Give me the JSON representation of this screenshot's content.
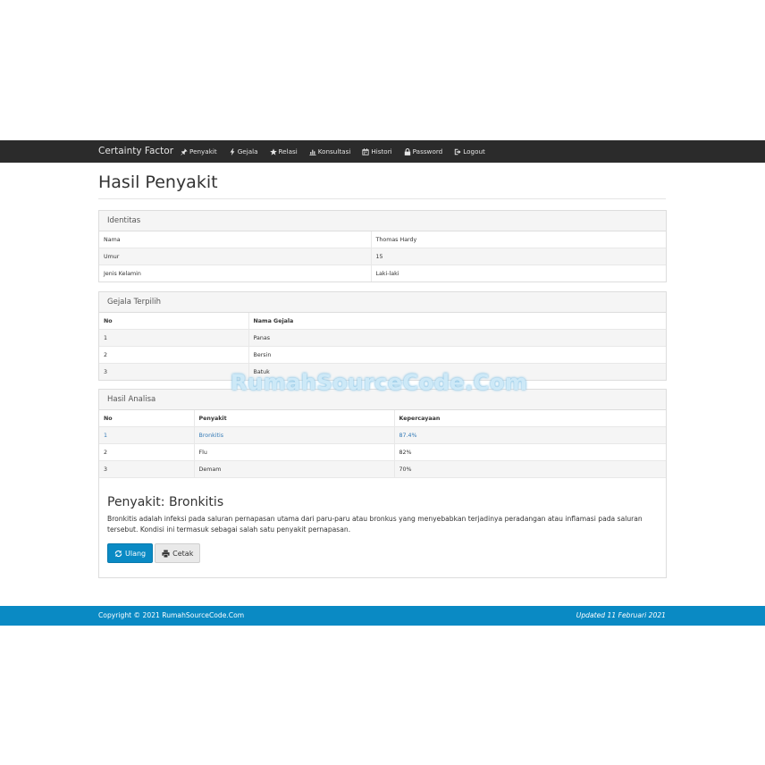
{
  "navbar": {
    "brand": "Certainty Factor",
    "items": [
      {
        "label": "Penyakit",
        "icon": "pushpin-icon"
      },
      {
        "label": "Gejala",
        "icon": "flash-icon"
      },
      {
        "label": "Relasi",
        "icon": "star-icon"
      },
      {
        "label": "Konsultasi",
        "icon": "stats-icon"
      },
      {
        "label": "Histori",
        "icon": "calendar-icon"
      },
      {
        "label": "Password",
        "icon": "lock-icon"
      },
      {
        "label": "Logout",
        "icon": "logout-icon"
      }
    ]
  },
  "page": {
    "title": "Hasil Penyakit"
  },
  "identitas": {
    "heading": "Identitas",
    "rows": [
      {
        "label": "Nama",
        "value": "Thomas Hardy"
      },
      {
        "label": "Umur",
        "value": "15"
      },
      {
        "label": "Jenis Kelamin",
        "value": "Laki-laki"
      }
    ]
  },
  "gejala": {
    "heading": "Gejala Terpilih",
    "col_no": "No",
    "col_nama": "Nama Gejala",
    "rows": [
      {
        "no": "1",
        "nama": "Panas"
      },
      {
        "no": "2",
        "nama": "Bersin"
      },
      {
        "no": "3",
        "nama": "Batuk"
      }
    ]
  },
  "analisa": {
    "heading": "Hasil Analisa",
    "col_no": "No",
    "col_penyakit": "Penyakit",
    "col_kepercayaan": "Kepercayaan",
    "rows": [
      {
        "no": "1",
        "penyakit": "Bronkitis",
        "kepercayaan": "87.4%"
      },
      {
        "no": "2",
        "penyakit": "Flu",
        "kepercayaan": "82%"
      },
      {
        "no": "3",
        "penyakit": "Demam",
        "kepercayaan": "70%"
      }
    ],
    "result_title": "Penyakit: Bronkitis",
    "result_desc": "Bronkitis adalah infeksi pada saluran pernapasan utama dari paru-paru atau bronkus yang menyebabkan terjadinya peradangan atau inflamasi pada saluran tersebut. Kondisi ini termasuk sebagai salah satu penyakit pernapasan.",
    "btn_ulang": "Ulang",
    "btn_cetak": "Cetak"
  },
  "watermark": "RumahSourceCode.Com",
  "footer": {
    "copyright": "Copyright © 2021 RumahSourceCode.Com",
    "updated": "Updated 11 Februari 2021"
  },
  "colors": {
    "navbar": "#2b2b2b",
    "primary": "#0a8ac4",
    "link": "#337ab7"
  }
}
